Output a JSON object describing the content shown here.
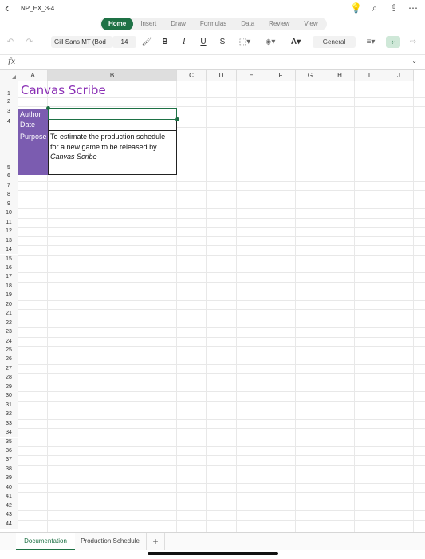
{
  "app": {
    "doc_title": "NP_EX_3-4",
    "tabs": [
      {
        "label": "Home",
        "active": true
      },
      {
        "label": "Insert",
        "active": false
      },
      {
        "label": "Draw",
        "active": false
      },
      {
        "label": "Formulas",
        "active": false
      },
      {
        "label": "Data",
        "active": false
      },
      {
        "label": "Review",
        "active": false
      },
      {
        "label": "View",
        "active": false
      }
    ]
  },
  "ribbon": {
    "font_name": "Gill Sans MT (Bod",
    "font_size": "14",
    "number_format": "General"
  },
  "formula_bar": {
    "fx": "fx",
    "value": ""
  },
  "columns": [
    "A",
    "B",
    "C",
    "D",
    "E",
    "F",
    "G",
    "H",
    "I",
    "J"
  ],
  "rows": [
    "1",
    "2",
    "3",
    "4",
    "5",
    "6",
    "7",
    "8",
    "9",
    "10",
    "11",
    "12",
    "13",
    "14",
    "15",
    "16",
    "17",
    "18",
    "19",
    "20",
    "21",
    "22",
    "23",
    "24",
    "25",
    "26",
    "27",
    "28",
    "29",
    "30",
    "31",
    "32",
    "33",
    "34",
    "35",
    "36",
    "37",
    "38",
    "39",
    "40",
    "41",
    "42",
    "43",
    "44"
  ],
  "cells": {
    "title": "Canvas Scribe",
    "author_label": "Author",
    "date_label": "Date",
    "purpose_label": "Purpose",
    "purpose_text": "To estimate the production schedule for a new game to be released by",
    "purpose_italic": "Canvas Scribe"
  },
  "sheets": [
    {
      "label": "Documentation",
      "active": true
    },
    {
      "label": "Production Schedule",
      "active": false
    }
  ],
  "add_sheet": "+",
  "colors": {
    "accent": "#1e7145",
    "title": "#8a2fb5",
    "label_fill": "#7b5cb0"
  }
}
